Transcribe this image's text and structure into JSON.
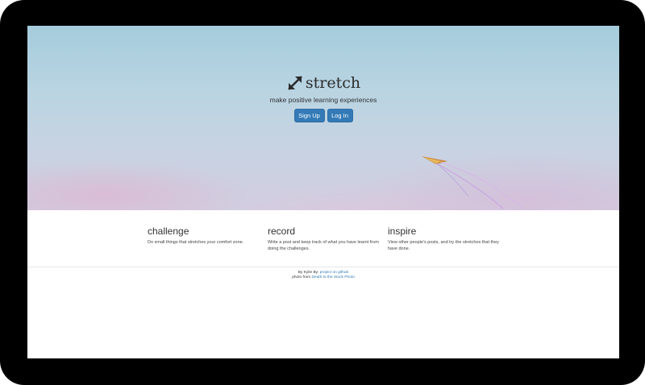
{
  "brand": {
    "name": "stretch",
    "icon": "diagonal-expand-arrows-icon",
    "tagline": "make positive learning experiences"
  },
  "buttons": {
    "signup": "Sign Up",
    "login": "Log In"
  },
  "features": [
    {
      "title": "challenge",
      "text": "Do small things that stretches your comfort zone."
    },
    {
      "title": "record",
      "text": "Write a post and keep track of what you have learnt from doing the challenges."
    },
    {
      "title": "inspire",
      "text": "View other people's posts, and try the stretches that they have done."
    }
  ],
  "footer": {
    "by_text": "By Kylie By:",
    "github_link": "project on github",
    "photo_text": "photo from",
    "photo_link": "Death to the Stock Photo"
  },
  "colors": {
    "primary": "#337ab7",
    "bezel": "#000000"
  }
}
